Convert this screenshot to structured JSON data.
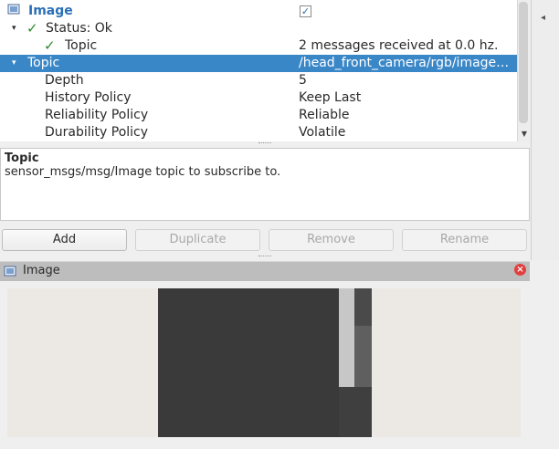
{
  "tree": {
    "root": {
      "label": "Image",
      "checked": "✓"
    },
    "status": {
      "label": "Status: Ok"
    },
    "topic_status": {
      "label": "Topic",
      "value": "2 messages received at 0.0 hz."
    },
    "topic": {
      "label": "Topic",
      "value": "/head_front_camera/rgb/image…"
    },
    "props": [
      {
        "label": "Depth",
        "value": "5"
      },
      {
        "label": "History Policy",
        "value": "Keep Last"
      },
      {
        "label": "Reliability Policy",
        "value": "Reliable"
      },
      {
        "label": "Durability Policy",
        "value": "Volatile"
      }
    ]
  },
  "description": {
    "title": "Topic",
    "body": "sensor_msgs/msg/Image topic to subscribe to."
  },
  "buttons": {
    "add": "Add",
    "duplicate": "Duplicate",
    "remove": "Remove",
    "rename": "Rename"
  },
  "panel": {
    "title": "Image"
  },
  "icons": {
    "expand": "▾",
    "check": "✓",
    "scroll_up": "▲",
    "scroll_down": "▼",
    "collapse_side": "◂",
    "close": "×"
  },
  "colors": {
    "selection": "#3a87c8",
    "ok_check": "#2d8a2d",
    "close": "#e04040"
  }
}
